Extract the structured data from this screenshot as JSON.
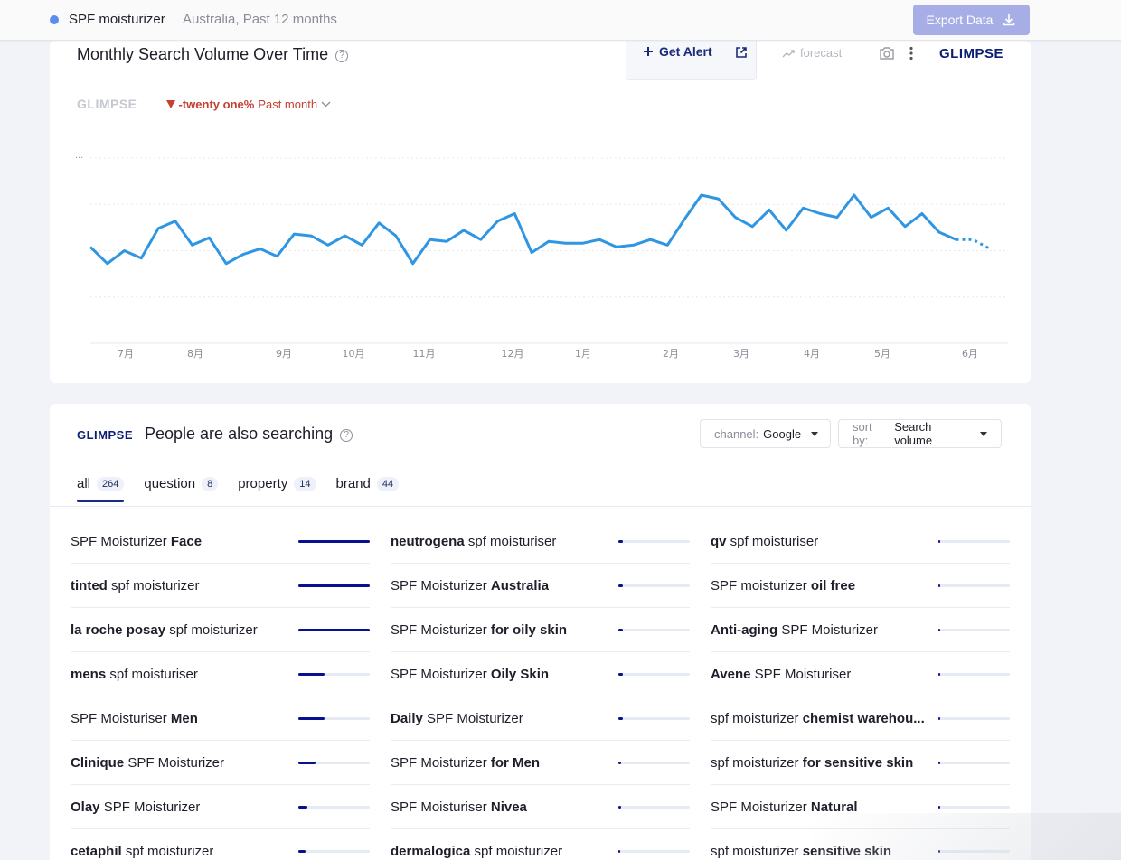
{
  "topbar": {
    "keyword": "SPF moisturizer",
    "context": "Australia, Past 12 months",
    "export_label": "Export Data",
    "dot_color": "#5b8def"
  },
  "trend": {
    "title": "Monthly Search Volume Over Time",
    "get_alert_label": "Get Alert",
    "forecast_label": "forecast",
    "logo_text": "GLIMPSE",
    "watermark_text": "GLIMPSE",
    "change_value": "-twenty one%",
    "change_period": "Past month",
    "change_color": "#c44134",
    "y_max_label": "..."
  },
  "chart_data": {
    "type": "line",
    "x_ticks": [
      "7月",
      "8月",
      "9月",
      "10月",
      "11月",
      "12月",
      "1月",
      "2月",
      "3月",
      "4月",
      "5月",
      "6月"
    ],
    "y_range": [
      0,
      100
    ],
    "grid": true,
    "line_color": "#2e96e2",
    "values": [
      52,
      43,
      50,
      46,
      62,
      66,
      53,
      57,
      43,
      48,
      51,
      47,
      59,
      58,
      53,
      58,
      53,
      65,
      58,
      43,
      56,
      55,
      61,
      56,
      66,
      70,
      49,
      55,
      54,
      54,
      56,
      52,
      53,
      56,
      53,
      67,
      80,
      78,
      68,
      63,
      72,
      61,
      73,
      70,
      68,
      80,
      68,
      73,
      63,
      70,
      60,
      56
    ],
    "forecast_values": [
      56,
      51
    ]
  },
  "related": {
    "logo_text": "GLIMPSE",
    "title": "People are also searching",
    "channel_label": "channel:",
    "channel_value": "Google",
    "sort_label": "sort by:",
    "sort_value": "Search volume",
    "tabs": [
      {
        "label": "all",
        "count": "264"
      },
      {
        "label": "question",
        "count": "8"
      },
      {
        "label": "property",
        "count": "14"
      },
      {
        "label": "brand",
        "count": "44"
      }
    ],
    "columns": [
      [
        {
          "pre": "SPF Moisturizer ",
          "bold": "Face",
          "post": "",
          "level": 1.0
        },
        {
          "pre": "",
          "bold": "tinted",
          "post": " spf moisturizer",
          "level": 1.0
        },
        {
          "pre": "",
          "bold": "la roche posay",
          "post": " spf moisturizer",
          "level": 1.0
        },
        {
          "pre": "",
          "bold": "mens",
          "post": " spf moisturiser",
          "level": 0.37
        },
        {
          "pre": "SPF Moisturiser ",
          "bold": "Men",
          "post": "",
          "level": 0.37
        },
        {
          "pre": "",
          "bold": "Clinique",
          "post": " SPF Moisturizer",
          "level": 0.24
        },
        {
          "pre": "",
          "bold": "Olay",
          "post": " SPF Moisturizer",
          "level": 0.13
        },
        {
          "pre": "",
          "bold": "cetaphil",
          "post": " spf moisturizer",
          "level": 0.1
        }
      ],
      [
        {
          "pre": "",
          "bold": "neutrogena",
          "post": " spf moisturiser",
          "level": 0.06
        },
        {
          "pre": "SPF Moisturizer ",
          "bold": "Australia",
          "post": "",
          "level": 0.06
        },
        {
          "pre": "SPF Moisturizer ",
          "bold": "for oily skin",
          "post": "",
          "level": 0.06
        },
        {
          "pre": "SPF Moisturizer ",
          "bold": "Oily Skin",
          "post": "",
          "level": 0.06
        },
        {
          "pre": "",
          "bold": "Daily",
          "post": " SPF Moisturizer",
          "level": 0.06
        },
        {
          "pre": "SPF Moisturizer ",
          "bold": "for Men",
          "post": "",
          "level": 0.04
        },
        {
          "pre": "SPF Moisturiser ",
          "bold": "Nivea",
          "post": "",
          "level": 0.04
        },
        {
          "pre": "",
          "bold": "dermalogica",
          "post": " spf moisturizer",
          "level": 0.03
        }
      ],
      [
        {
          "pre": "",
          "bold": "qv",
          "post": " spf moisturiser",
          "level": 0.03
        },
        {
          "pre": "SPF moisturizer ",
          "bold": "oil free",
          "post": "",
          "level": 0.03
        },
        {
          "pre": "",
          "bold": "Anti-aging",
          "post": " SPF Moisturizer",
          "level": 0.02
        },
        {
          "pre": "",
          "bold": "Avene",
          "post": " SPF Moisturiser",
          "level": 0.02
        },
        {
          "pre": "spf moisturizer ",
          "bold": "chemist warehou...",
          "post": "",
          "level": 0.02
        },
        {
          "pre": "spf moisturizer ",
          "bold": "for sensitive skin",
          "post": "",
          "level": 0.02
        },
        {
          "pre": "SPF Moisturizer ",
          "bold": "Natural",
          "post": "",
          "level": 0.02
        },
        {
          "pre": "spf moisturizer ",
          "bold": "sensitive skin",
          "post": "",
          "level": 0.02
        }
      ]
    ]
  }
}
